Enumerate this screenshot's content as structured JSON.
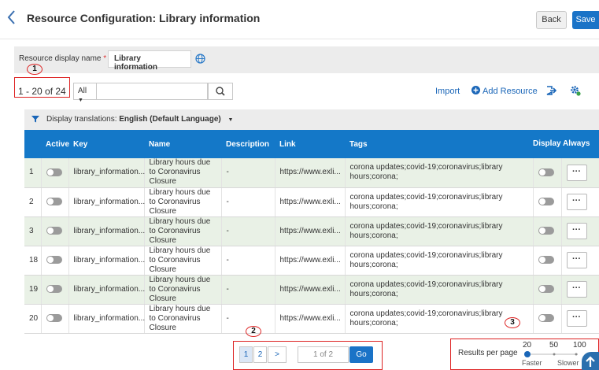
{
  "header": {
    "title": "Resource Configuration: Library information",
    "back_label": "Back",
    "save_label": "Save"
  },
  "name_field": {
    "label": "Resource display name",
    "required_mark": "*",
    "value": "Library information"
  },
  "toolbar": {
    "count_text": "1 - 20 of 24",
    "filter_value": "All",
    "search_placeholder": "",
    "import_label": "Import",
    "add_resource_label": "Add Resource"
  },
  "translations": {
    "label": "Display translations:",
    "value": "English (Default Language)"
  },
  "table": {
    "headers": {
      "active": "Active",
      "key": "Key",
      "name": "Name",
      "description": "Description",
      "link": "Link",
      "tags": "Tags",
      "display_always": "Display Always"
    },
    "rows": [
      {
        "num": "1",
        "key": "library_information...",
        "name": "Library hours due to Coronavirus Closure",
        "description": "-",
        "link": "https://www.exli...",
        "tags": "corona updates;covid-19;coronavirus;library hours;corona;"
      },
      {
        "num": "2",
        "key": "library_information...",
        "name": "Library hours due to Coronavirus Closure",
        "description": "-",
        "link": "https://www.exli...",
        "tags": "corona updates;covid-19;coronavirus;library hours;corona;"
      },
      {
        "num": "3",
        "key": "library_information...",
        "name": "Library hours due to Coronavirus Closure",
        "description": "-",
        "link": "https://www.exli...",
        "tags": "corona updates;covid-19;coronavirus;library hours;corona;"
      },
      {
        "num": "18",
        "key": "library_information...",
        "name": "Library hours due to Coronavirus Closure",
        "description": "-",
        "link": "https://www.exli...",
        "tags": "corona updates;covid-19;coronavirus;library hours;corona;"
      },
      {
        "num": "19",
        "key": "library_information...",
        "name": "Library hours due to Coronavirus Closure",
        "description": "-",
        "link": "https://www.exli...",
        "tags": "corona updates;covid-19;coronavirus;library hours;corona;"
      },
      {
        "num": "20",
        "key": "library_information...",
        "name": "Library hours due to Coronavirus Closure",
        "description": "-",
        "link": "https://www.exli...",
        "tags": "corona updates;covid-19;coronavirus;library hours;corona;"
      }
    ],
    "row_actions_label": "···"
  },
  "pagination": {
    "pages": [
      "1",
      "2"
    ],
    "next": ">",
    "page_input": "1 of 2",
    "go_label": "Go"
  },
  "results_per_page": {
    "label": "Results per page",
    "options": [
      "20",
      "50",
      "100"
    ],
    "faster": "Faster",
    "slower": "Slower",
    "selected": "20"
  },
  "callouts": [
    "1",
    "2",
    "3"
  ],
  "colors": {
    "accent": "#1478c8",
    "callout": "#d22222",
    "row_alt": "#e9f1e6"
  }
}
